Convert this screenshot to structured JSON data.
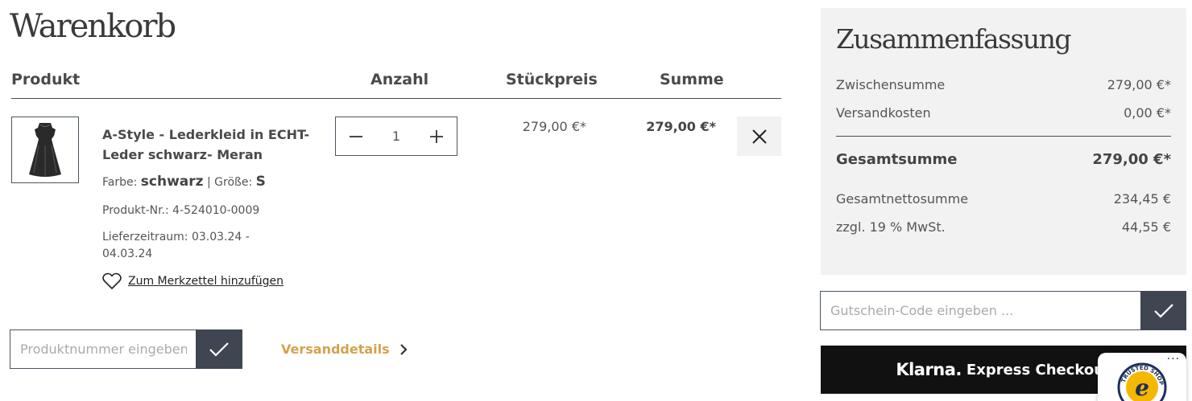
{
  "cart": {
    "title": "Warenkorb",
    "columns": {
      "product": "Produkt",
      "quantity": "Anzahl",
      "unit_price": "Stückpreis",
      "sum": "Summe"
    }
  },
  "item": {
    "name": "A-Style - Lederkleid in ECHT-Leder schwarz- Meran",
    "color_label": "Farbe:",
    "color_value": "schwarz",
    "separator": "|",
    "size_label": "Größe:",
    "size_value": "S",
    "product_number": "Produkt-Nr.: 4-524010-0009",
    "delivery": "Lieferzeitraum: 03.03.24 - 04.03.24",
    "wishlist_label": "Zum Merkzettel hinzufügen",
    "quantity": "1",
    "unit_price": "279,00 €*",
    "line_total": "279,00 €*"
  },
  "product_number_input": {
    "placeholder": "Produktnummer eingeben ..."
  },
  "shipping_details_label": "Versanddetails",
  "summary": {
    "title": "Zusammenfassung",
    "subtotal_label": "Zwischensumme",
    "subtotal_value": "279,00 €*",
    "shipping_label": "Versandkosten",
    "shipping_value": "0,00 €*",
    "total_label": "Gesamtsumme",
    "total_value": "279,00 €*",
    "net_label": "Gesamtnettosumme",
    "net_value": "234,45 €",
    "vat_label": "zzgl. 19 % MwSt.",
    "vat_value": "44,55 €"
  },
  "voucher": {
    "placeholder": "Gutschein-Code eingeben ..."
  },
  "klarna": {
    "brand": "Klarna.",
    "text": "Express Checkout"
  },
  "trusted_shops": {
    "dots": "···",
    "seal_top": "TRUSTED SHOPS",
    "seal_letter": "e"
  },
  "colors": {
    "accent": "#d4a24c",
    "button_dark": "#3f4652",
    "summary_bg": "#f2f2f2",
    "klarna_bg": "#111111"
  }
}
